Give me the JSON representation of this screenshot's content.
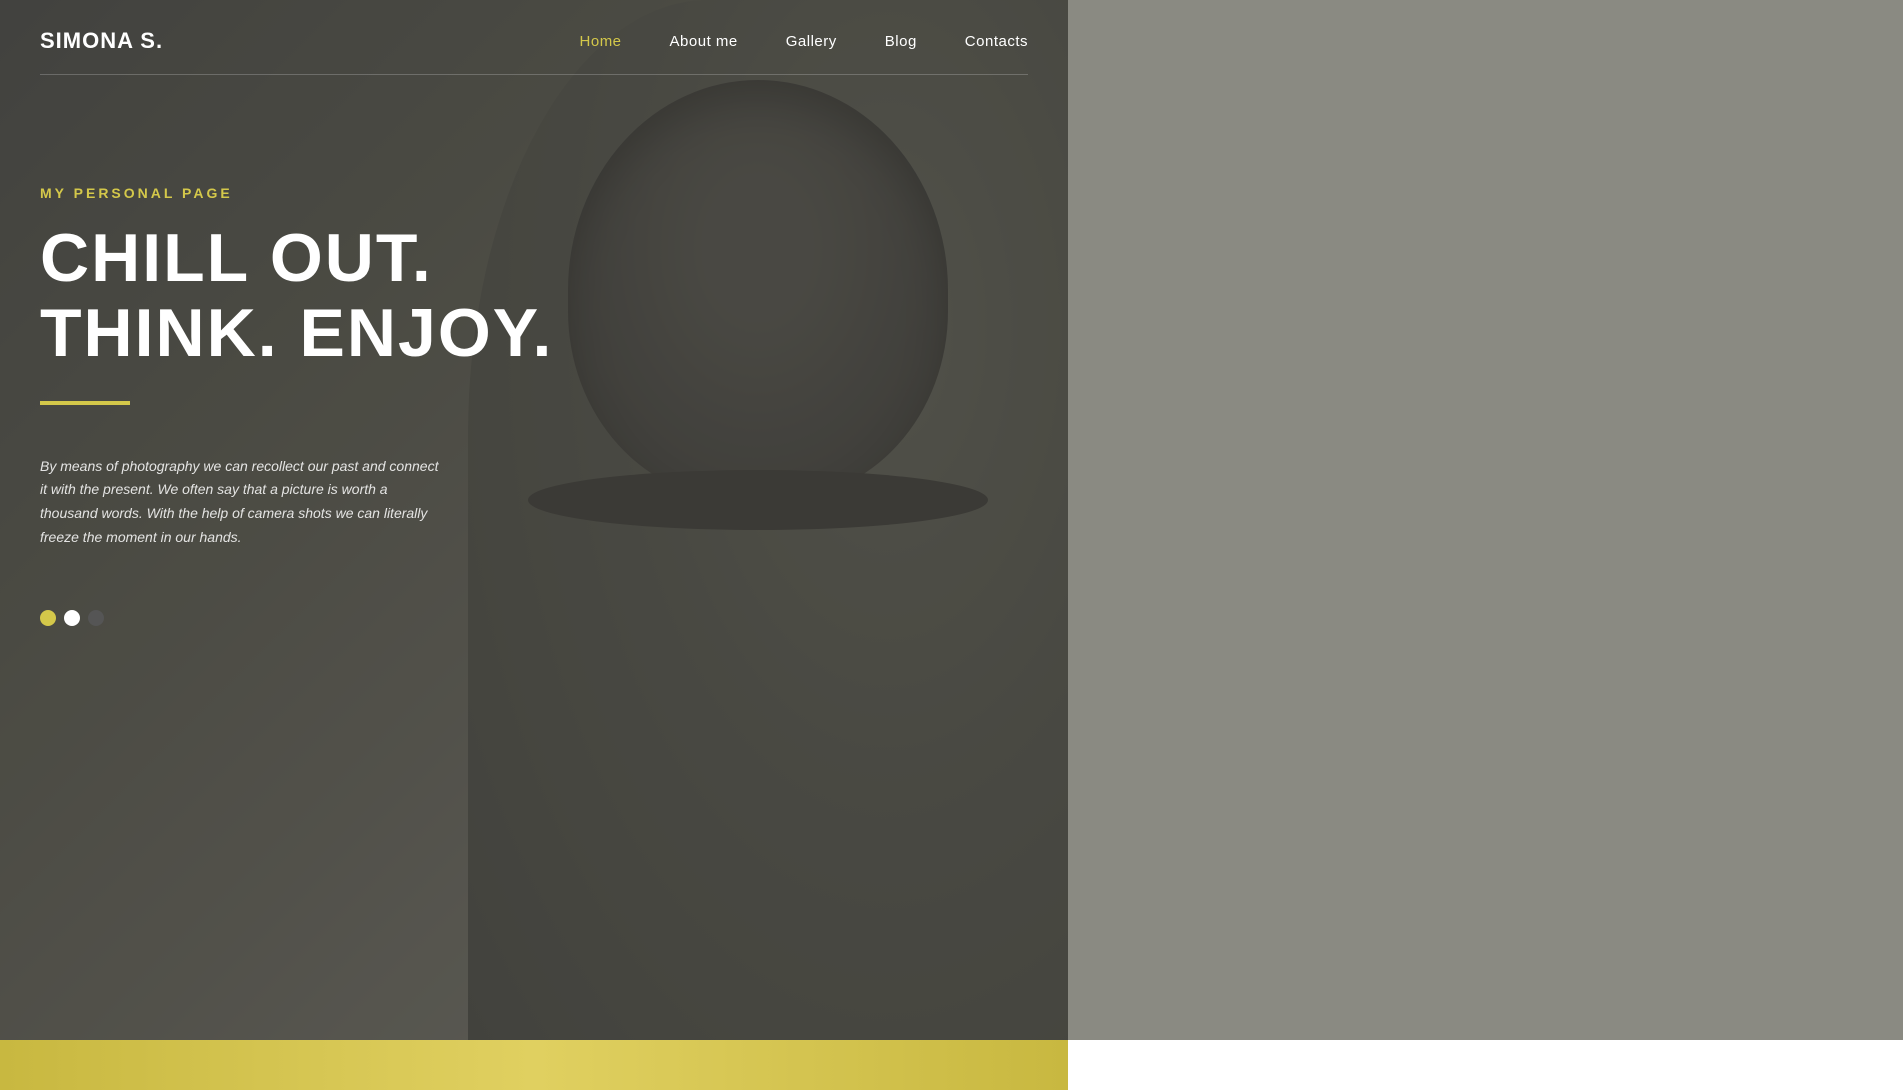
{
  "logo": {
    "text": "SIMONA S."
  },
  "nav": {
    "items": [
      {
        "id": "home",
        "label": "Home",
        "active": true
      },
      {
        "id": "about",
        "label": "About me",
        "active": false
      },
      {
        "id": "gallery",
        "label": "Gallery",
        "active": false
      },
      {
        "id": "blog",
        "label": "Blog",
        "active": false
      },
      {
        "id": "contacts",
        "label": "Contacts",
        "active": false
      }
    ]
  },
  "hero": {
    "subtitle": "MY PERSONAL PAGE",
    "title_line1": "CHILL OUT.",
    "title_line2": "THINK. ENJOY.",
    "description": "By means of photography we can recollect our past and connect it with the present. We often say that a picture is worth a thousand words. With the help of camera shots we can literally freeze the moment in our hands."
  },
  "slider": {
    "dots": [
      {
        "id": 1,
        "state": "active"
      },
      {
        "id": 2,
        "state": "inactive-white"
      },
      {
        "id": 3,
        "state": "inactive-dark"
      }
    ]
  },
  "colors": {
    "accent": "#d4c84a",
    "text_primary": "#ffffff",
    "bg_main": "#5a5a5a",
    "bg_sidebar": "#8a8a82"
  }
}
